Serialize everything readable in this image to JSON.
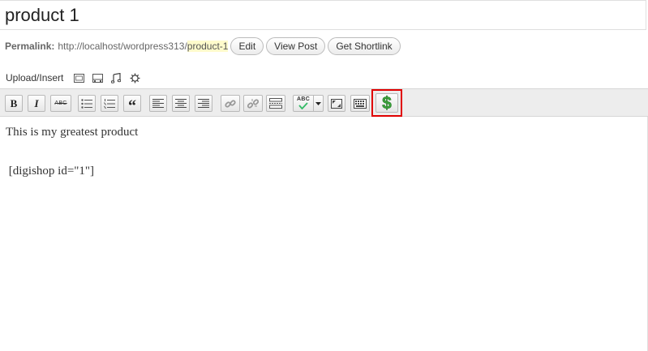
{
  "post": {
    "title": "product 1"
  },
  "permalink": {
    "label": "Permalink:",
    "base_url": "http://localhost/wordpress313/",
    "slug": "product-1",
    "buttons": [
      "Edit",
      "View Post",
      "Get Shortlink"
    ]
  },
  "upload": {
    "label": "Upload/Insert",
    "icons": [
      "image-icon",
      "video-icon",
      "audio-icon",
      "media-icon"
    ]
  },
  "toolbar": {
    "bold": "B",
    "italic": "I",
    "strike": "ABC",
    "blockquote": "“",
    "spellcheck": "ABC",
    "buttons": [
      "bold",
      "italic",
      "strikethrough",
      "bullet-list",
      "numbered-list",
      "blockquote",
      "align-left",
      "align-center",
      "align-right",
      "insert-link",
      "remove-link",
      "insert-more",
      "spellcheck",
      "spellcheck-dropdown",
      "fullscreen",
      "kitchen-sink",
      "digishop-insert"
    ],
    "highlighted_button": "digishop-insert",
    "highlight_color": "#e00000",
    "dollar_color": "#3aa23a"
  },
  "editor": {
    "lines": [
      "This is my greatest product",
      " [digishop id=\"1\"]"
    ]
  }
}
